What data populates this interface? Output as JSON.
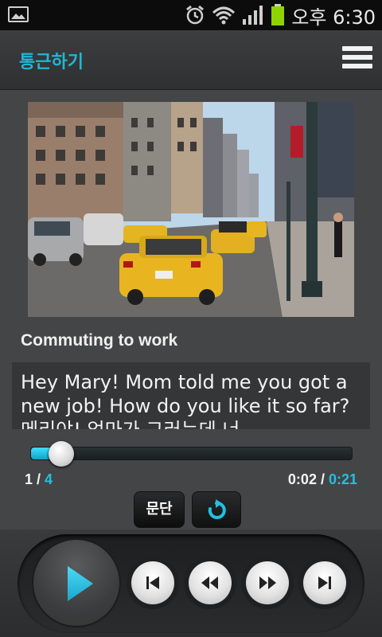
{
  "status_bar": {
    "time": "오후 6:30",
    "battery_color": "#8fd400"
  },
  "header": {
    "title": "통근하기",
    "menu_icon": "hamburger-menu-icon"
  },
  "lesson": {
    "title": "Commuting to work",
    "text_line1": "Hey Mary! Mom told me you got a",
    "text_line2": "new job! How do you like it so far?",
    "text_line3": "메리야! 엄마가 그러는데 너"
  },
  "player": {
    "progress": 0.1,
    "paragraph_current": "1",
    "paragraph_separator": " / ",
    "paragraph_total": "4",
    "time_elapsed": "0:02",
    "time_separator": " / ",
    "time_total": "0:21",
    "paragraph_button": "문단"
  },
  "colors": {
    "accent": "#22c1e0",
    "title": "#1fb7d3"
  }
}
